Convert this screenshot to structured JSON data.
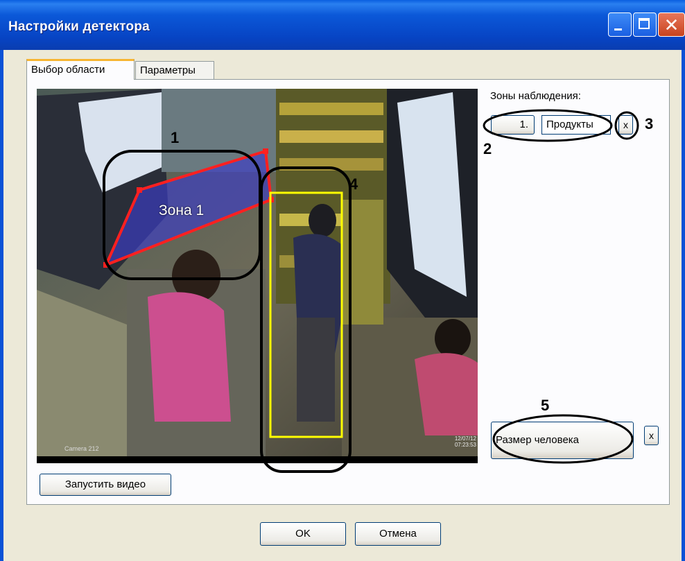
{
  "window": {
    "title": "Настройки детектора"
  },
  "tabs": [
    {
      "label": "Выбор области",
      "active": true
    },
    {
      "label": "Параметры",
      "active": false
    }
  ],
  "video": {
    "zone_label": "Зона 1",
    "timestamp": "12/07/12 07:23:53",
    "camera_label": "Camera 212"
  },
  "zones": {
    "title": "Зоны наблюдения:",
    "items": [
      {
        "number": "1.",
        "name": "Продукты",
        "delete_label": "x"
      }
    ]
  },
  "person_size": {
    "button_label": "Размер человека",
    "delete_label": "x"
  },
  "buttons": {
    "start_video": "Запустить видео",
    "ok": "OK",
    "cancel": "Отмена"
  },
  "callouts": [
    "1",
    "2",
    "3",
    "4",
    "5"
  ],
  "colors": {
    "titlebar": "#0a52d6",
    "zone_polygon": "#ff2020",
    "zone_fill": "#3c3cc8",
    "person_box": "#ffff00",
    "tab_highlight": "#f7b532"
  }
}
